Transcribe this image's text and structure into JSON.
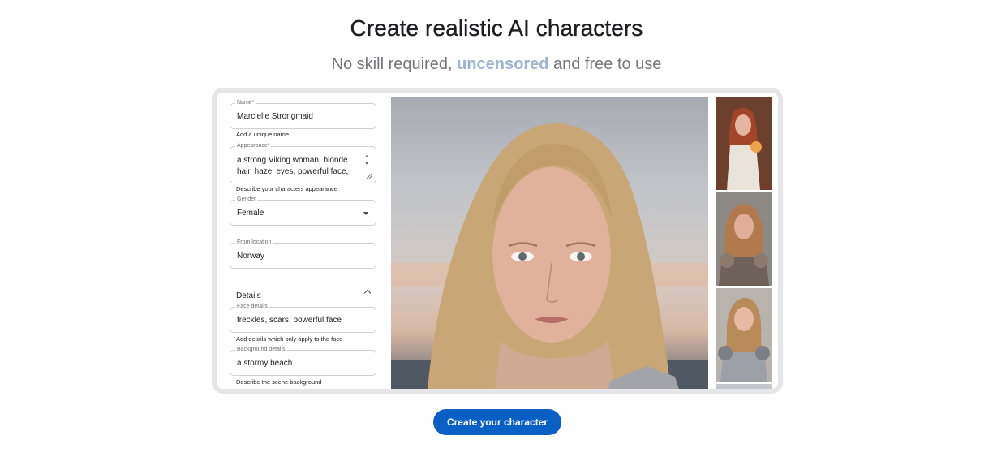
{
  "hero": {
    "title": "Create realistic AI characters",
    "subtitle_before": "No skill required, ",
    "subtitle_accent": "uncensored",
    "subtitle_after": " and free to use"
  },
  "form": {
    "name": {
      "label": "Name*",
      "value": "Marcielle Strongmaid",
      "helper": "Add a unique name"
    },
    "appearance": {
      "label": "Appearance*",
      "value_line1": "a strong Viking woman, blonde",
      "value_line2": "hair, hazel eyes, powerful face,",
      "helper": "Describe your characters appearance"
    },
    "gender": {
      "label": "Gender",
      "value": "Female"
    },
    "location": {
      "label": "From location",
      "value": "Norway"
    },
    "details": {
      "label": "Details",
      "face": {
        "label": "Face details",
        "value": "freckles, scars, powerful face",
        "helper": "Add details which only apply to the face"
      },
      "background": {
        "label": "Background details",
        "value": "a stormy beach",
        "helper": "Describe the scene background"
      }
    }
  },
  "icons": {
    "scroll": "textarea-scroll-icon",
    "resize": "resize-handle-icon",
    "dropdown": "chevron-down-icon",
    "collapse": "chevron-up-icon"
  },
  "cta": {
    "label": "Create your character"
  },
  "colors": {
    "accent": "#9fb4d1",
    "button": "#0a5fc4",
    "frame": "#e6e6e8"
  }
}
